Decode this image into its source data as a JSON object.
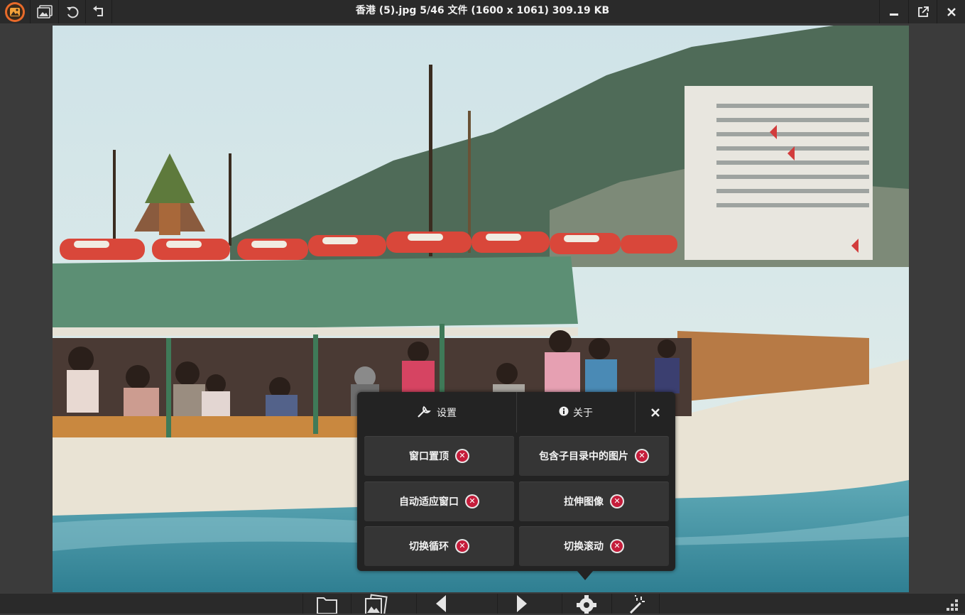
{
  "window": {
    "title": "香港 (5).jpg 5/46 文件 (1600 x 1061) 309.19 KB"
  },
  "titlebar": {
    "left_icons": [
      "app-logo-icon",
      "image-icon",
      "rotate-ccw-icon",
      "undo-icon"
    ],
    "right_icons": [
      "minimize-icon",
      "popout-icon",
      "close-icon"
    ]
  },
  "settings_panel": {
    "tabs": [
      {
        "icon": "wrench-icon",
        "label": "设置"
      },
      {
        "icon": "info-icon",
        "label": "关于"
      }
    ],
    "options": [
      {
        "label": "窗口置顶",
        "state": "off"
      },
      {
        "label": "包含子目录中的图片",
        "state": "off"
      },
      {
        "label": "自动适应窗口",
        "state": "off"
      },
      {
        "label": "拉伸图像",
        "state": "off"
      },
      {
        "label": "切换循环",
        "state": "off"
      },
      {
        "label": "切换滚动",
        "state": "off"
      }
    ],
    "colors": {
      "panel_bg": "#232323",
      "option_bg": "#353535",
      "badge_red": "#c51d3b"
    }
  },
  "bottom_toolbar": {
    "icons": [
      "folder-icon",
      "gallery-icon",
      "previous-icon",
      "next-icon",
      "settings-gear-icon",
      "magic-wand-icon",
      "resize-grip-icon"
    ]
  }
}
